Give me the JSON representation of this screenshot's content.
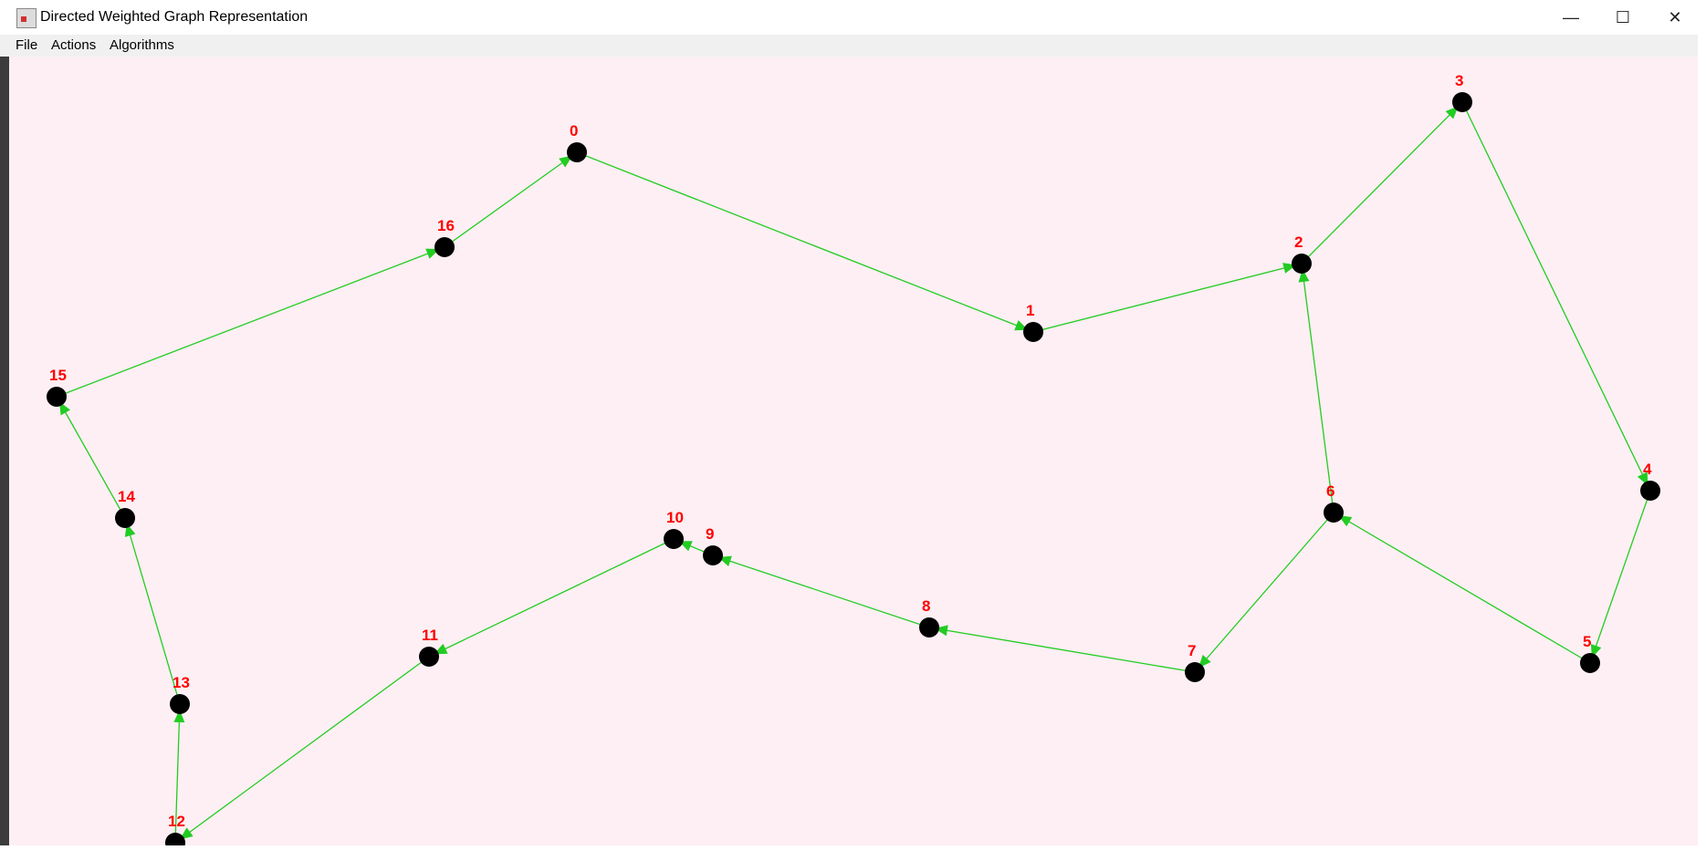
{
  "window": {
    "title": "Directed Weighted Graph Representation",
    "controls": [
      "—",
      "☐",
      "✕"
    ]
  },
  "menu": {
    "file": "File",
    "actions": "Actions",
    "algorithms": "Algorithms"
  },
  "graph": {
    "colors": {
      "background": "#fdeff3",
      "node": "#000000",
      "edge": "#22cc22",
      "label": "#ff0000"
    },
    "nodes": [
      {
        "id": "0"
      },
      {
        "id": "1"
      },
      {
        "id": "2"
      },
      {
        "id": "3"
      },
      {
        "id": "4"
      },
      {
        "id": "5"
      },
      {
        "id": "6"
      },
      {
        "id": "7"
      },
      {
        "id": "8"
      },
      {
        "id": "9"
      },
      {
        "id": "10"
      },
      {
        "id": "11"
      },
      {
        "id": "12"
      },
      {
        "id": "13"
      },
      {
        "id": "14"
      },
      {
        "id": "15"
      },
      {
        "id": "16"
      }
    ],
    "edges": [
      [
        "0",
        "1"
      ],
      [
        "1",
        "2"
      ],
      [
        "2",
        "3"
      ],
      [
        "3",
        "4"
      ],
      [
        "4",
        "5"
      ],
      [
        "5",
        "6"
      ],
      [
        "6",
        "2"
      ],
      [
        "6",
        "7"
      ],
      [
        "7",
        "8"
      ],
      [
        "8",
        "9"
      ],
      [
        "9",
        "10"
      ],
      [
        "10",
        "11"
      ],
      [
        "11",
        "12"
      ],
      [
        "12",
        "13"
      ],
      [
        "13",
        "14"
      ],
      [
        "14",
        "15"
      ],
      [
        "15",
        "16"
      ],
      [
        "16",
        "0"
      ]
    ]
  }
}
